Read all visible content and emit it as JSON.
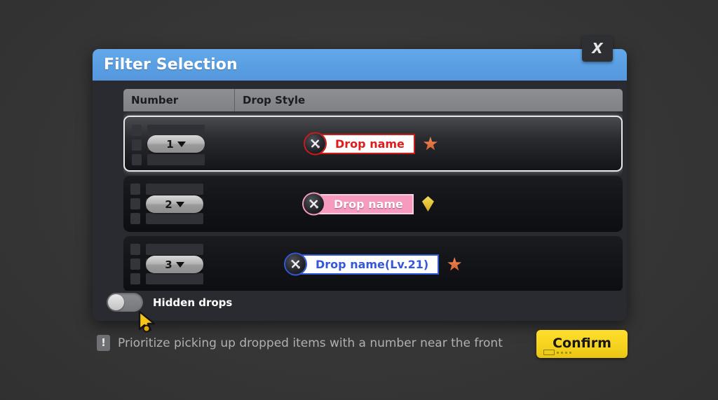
{
  "window": {
    "title": "Filter Selection",
    "close_label": "X"
  },
  "table": {
    "columns": [
      {
        "key": "number",
        "label": "Number"
      },
      {
        "key": "style",
        "label": "Drop Style"
      }
    ],
    "rows": [
      {
        "number": "1",
        "caret": "▼",
        "drop_label": "Drop name",
        "badge_style": "red",
        "badge_text_color": "#e01b1b",
        "badge_bg_color": "#ffffff",
        "badge_border_color": "#cf1a1a",
        "rarity_icon": "star-icon",
        "rarity_color": "#e07038",
        "selected": true
      },
      {
        "number": "2",
        "caret": "▼",
        "drop_label": "Drop name",
        "badge_style": "pink",
        "badge_text_color": "#ffffff",
        "badge_bg_color": "#f79ac0",
        "badge_border_color": "#f6cfe0",
        "rarity_icon": "gem-icon",
        "rarity_color": "#e8c53a",
        "selected": false
      },
      {
        "number": "3",
        "caret": "▼",
        "drop_label": "Drop name(Lv.21)",
        "badge_style": "blue",
        "badge_text_color": "#3558d8",
        "badge_bg_color": "#ffffff",
        "badge_border_color": "#3558d8",
        "rarity_icon": "star-icon",
        "rarity_color": "#e07038",
        "selected": false
      }
    ]
  },
  "hidden_drops": {
    "label": "Hidden drops",
    "enabled": false
  },
  "footer": {
    "info_icon": "exclamation-icon",
    "info_glyph": "!",
    "hint": "Prioritize picking up dropped items with a number near the front",
    "confirm_label": "Confirm"
  },
  "colors": {
    "titlebar": "#5a9fe3",
    "dialog_bg": "#2a2b31",
    "confirm": "#f5d21d",
    "page_bg": "#343434"
  }
}
